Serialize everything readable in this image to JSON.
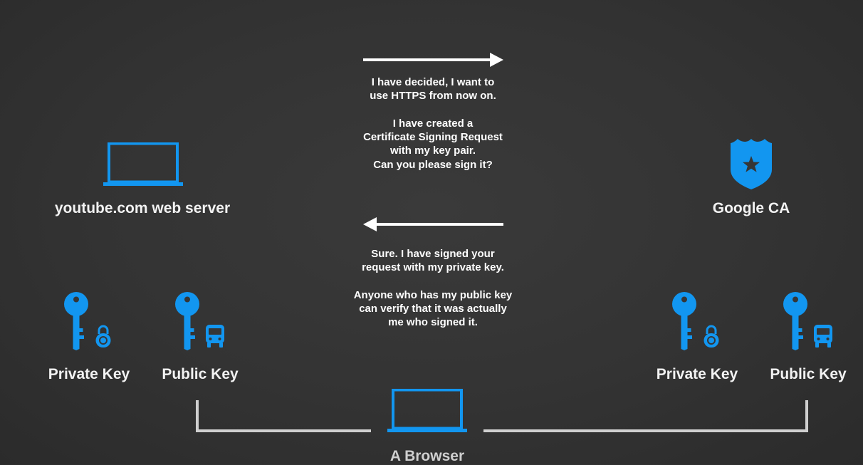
{
  "colors": {
    "background": "#353535",
    "accent": "#1296f0",
    "text": "#f2f2f2",
    "bracket": "#cfcfcf"
  },
  "server": {
    "label": "youtube.com web server",
    "icon": "laptop-icon"
  },
  "ca": {
    "label": "Google CA",
    "icon": "police-badge-icon"
  },
  "browser": {
    "label": "A Browser",
    "icon": "laptop-icon"
  },
  "messages": {
    "request": {
      "direction": "right",
      "lines_a": [
        "I have decided, I want to",
        "use HTTPS from now on."
      ],
      "lines_b": [
        "I have created a",
        "Certificate Signing Request",
        "with my key pair.",
        "Can you please sign it?"
      ]
    },
    "response": {
      "direction": "left",
      "lines_a": [
        "Sure. I have signed your",
        "request with my private key."
      ],
      "lines_b": [
        "Anyone who has my public key",
        "can verify that it was actually",
        "me who signed it."
      ]
    }
  },
  "server_keys": [
    {
      "label": "Private Key",
      "icon": "key-icon",
      "badge": "padlock-icon"
    },
    {
      "label": "Public Key",
      "icon": "key-icon",
      "badge": "bus-icon"
    }
  ],
  "ca_keys": [
    {
      "label": "Private Key",
      "icon": "key-icon",
      "badge": "padlock-icon"
    },
    {
      "label": "Public Key",
      "icon": "key-icon",
      "badge": "bus-icon"
    }
  ]
}
